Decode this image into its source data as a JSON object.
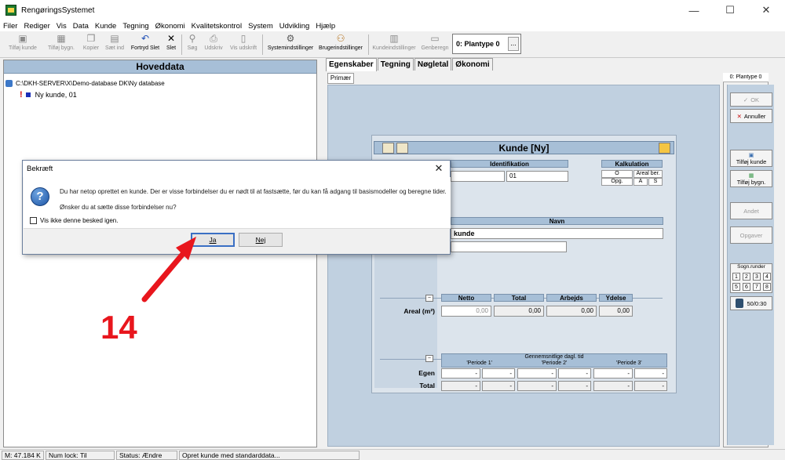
{
  "window": {
    "title": "RengøringsSystemet",
    "minimize": "—",
    "maximize": "☐",
    "close": "✕"
  },
  "menu": [
    "Filer",
    "Rediger",
    "Vis",
    "Data",
    "Kunde",
    "Tegning",
    "Økonomi",
    "Kvalitetskontrol",
    "System",
    "Udvikling",
    "Hjælp"
  ],
  "toolbar": {
    "add_customer": "Tilføj kunde",
    "add_building": "Tilføj bygn.",
    "copy": "Kopier",
    "paste": "Sæt ind",
    "undo_delete": "Fortryd Slet",
    "delete": "Slet",
    "search": "Søg",
    "print": "Udskriv",
    "view_print": "Vis udskrift",
    "system_settings": "Systemindstillinger",
    "user_settings": "Brugerindstillinger",
    "customer_settings": "Kundeindstillinger",
    "recalculate": "Genberegn",
    "plantype": "0: Plantype 0",
    "plantype_more": "..."
  },
  "left_panel": {
    "header": "Hoveddata",
    "db_path": "C:\\DKH-SERVER\\X\\Demo-database DK\\Ny database",
    "new_customer": "Ny kunde, 01"
  },
  "tabs": [
    "Egenskaber",
    "Tegning",
    "Nøgletal",
    "Økonomi"
  ],
  "subtab": "Primær",
  "kunde": {
    "title": "Kunde [Ny]",
    "identifikation": "Identifikation",
    "id_value": "01",
    "kalkulation": "Kalkulation",
    "calc_o": "O",
    "calc_areal": "Areal ber.",
    "calc_opg": "Opg.",
    "calc_a": "A",
    "calc_s": "S",
    "navn": "Navn",
    "name_value": "kunde",
    "areal_label": "Areal (m²)",
    "netto": "Netto",
    "total": "Total",
    "arbejds": "Arbejds",
    "ydelse": "Ydelse",
    "netto_val": "0,00",
    "total_val": "0,00",
    "arbejds_val": "0,00",
    "ydelse_val": "0,00",
    "gns_header": "Gennemsnitlige dagl. tid",
    "periode1": "'Periode 1'",
    "periode2": "'Periode 2'",
    "periode3": "'Periode 3'",
    "egen": "Egen",
    "total_row": "Total",
    "dash": "-",
    "collapse": "–"
  },
  "sidebar": {
    "plantype": "0: Plantype 0",
    "ok": "OK",
    "cancel": "Annuller",
    "add_customer": "Tilføj kunde",
    "add_building": "Tilføj bygn.",
    "other": "Andet",
    "tasks": "Opgaver",
    "rounds_title": "Sogn.runder",
    "rounds": [
      "1",
      "2",
      "3",
      "4",
      "5",
      "6",
      "7",
      "8"
    ],
    "counter": "50/0:30"
  },
  "dialog": {
    "title": "Bekræft",
    "close": "✕",
    "message1": "Du har netop oprettet en kunde. Der er visse forbindelser du er nødt til at fastsætte, før du kan få adgang til basismodeller og beregne tider.",
    "message2": "Ønsker du at sætte disse forbindelser nu?",
    "dont_show": "Vis ikke denne besked igen.",
    "yes": "Ja",
    "no": "Nej"
  },
  "annotation": {
    "step": "14",
    "color": "#e8161d"
  },
  "status": {
    "memory": "M: 47.184 K",
    "numlock": "Num lock: Til",
    "state": "Status: Ændre",
    "message": "Opret kunde med standarddata..."
  }
}
